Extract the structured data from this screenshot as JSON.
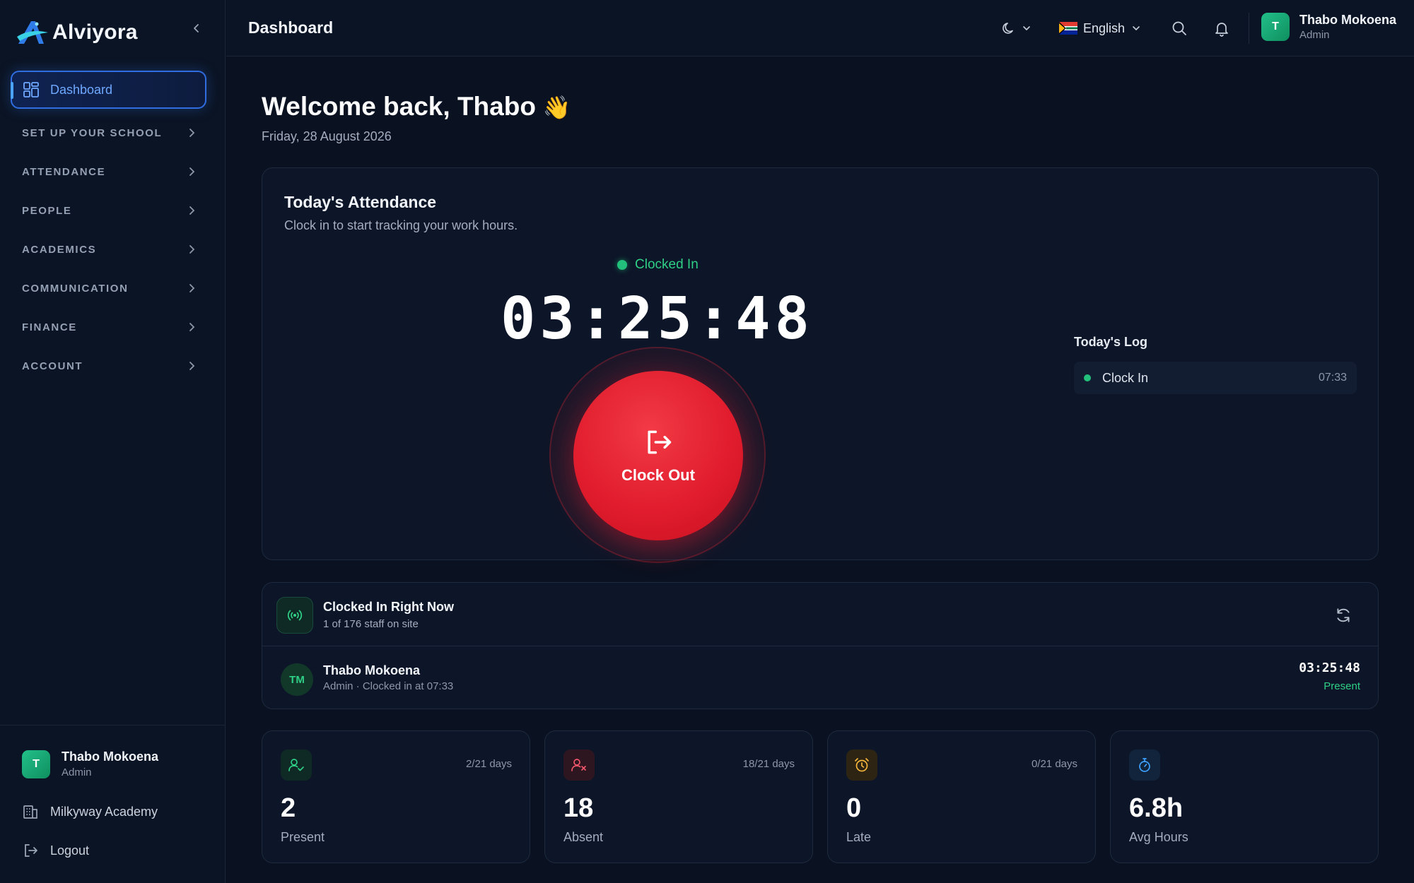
{
  "app": {
    "name": "Alviyora"
  },
  "sidebar": {
    "active_item": "Dashboard",
    "sections": [
      "SET UP YOUR SCHOOL",
      "ATTENDANCE",
      "PEOPLE",
      "ACADEMICS",
      "COMMUNICATION",
      "FINANCE",
      "ACCOUNT"
    ],
    "user": {
      "initial": "T",
      "name": "Thabo Mokoena",
      "role": "Admin"
    },
    "school": "Milkyway Academy",
    "logout": "Logout"
  },
  "header": {
    "title": "Dashboard",
    "language": "English",
    "user": {
      "initial": "T",
      "name": "Thabo Mokoena",
      "role": "Admin"
    }
  },
  "welcome": {
    "greeting": "Welcome back, Thabo",
    "emoji": "👋",
    "date": "Friday, 28 August 2026"
  },
  "attendance": {
    "title": "Today's Attendance",
    "subtitle": "Clock in to start tracking your work hours.",
    "status": "Clocked In",
    "timer": "03:25:48",
    "button_label": "Clock Out",
    "log_title": "Today's Log",
    "log": [
      {
        "label": "Clock In",
        "time": "07:33"
      }
    ]
  },
  "clocked_now": {
    "title": "Clocked In Right Now",
    "subtitle": "1 of 176 staff on site",
    "staff": {
      "initials": "TM",
      "name": "Thabo Mokoena",
      "detail": "Admin · Clocked in at 07:33",
      "timer": "03:25:48",
      "status": "Present"
    }
  },
  "stats": [
    {
      "value": "2",
      "label": "Present",
      "days": "2/21 days",
      "icon": "user-check-icon",
      "color": "#2fcf86"
    },
    {
      "value": "18",
      "label": "Absent",
      "days": "18/21 days",
      "icon": "user-x-icon",
      "color": "#f0566a"
    },
    {
      "value": "0",
      "label": "Late",
      "days": "0/21 days",
      "icon": "alarm-clock-icon",
      "color": "#f5b63a"
    },
    {
      "value": "6.8h",
      "label": "Avg Hours",
      "days": "",
      "icon": "stopwatch-icon",
      "color": "#3da2ff"
    }
  ],
  "colors": {
    "accent": "#2f6de0",
    "success": "#2fcf86",
    "danger": "#e11d2e",
    "background": "#0a1120"
  }
}
